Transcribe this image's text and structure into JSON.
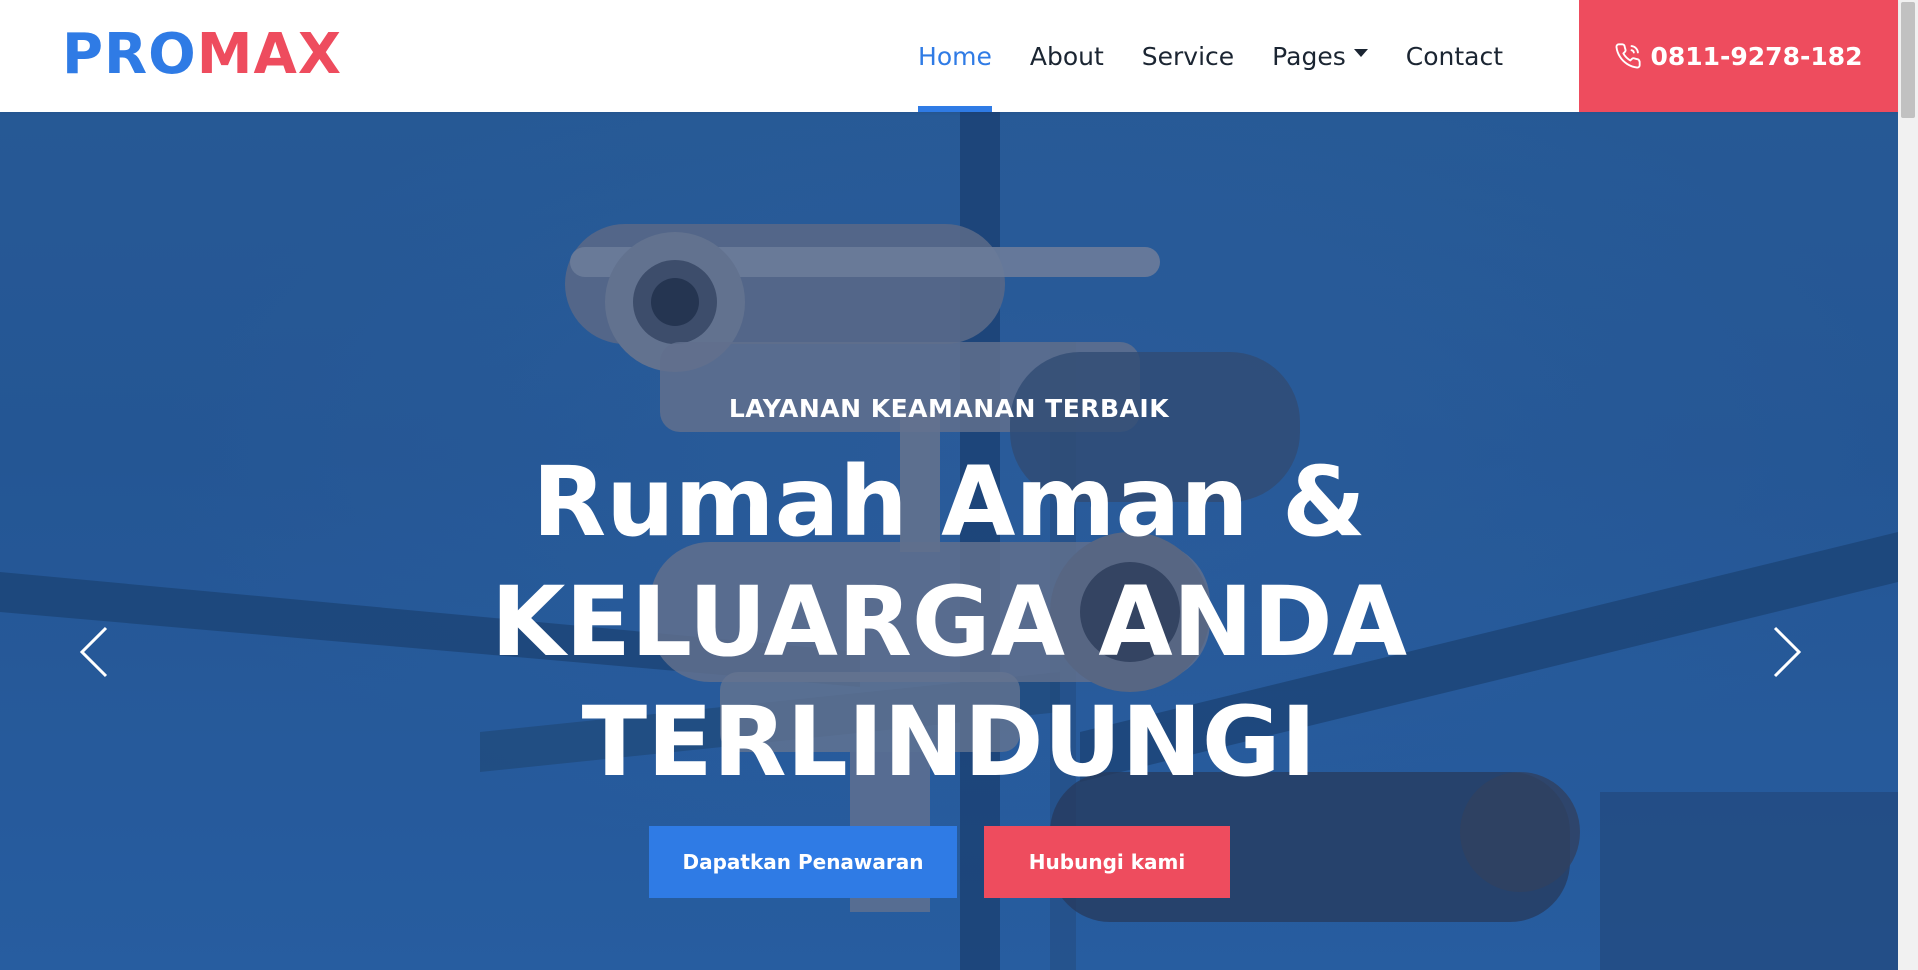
{
  "brand": {
    "part1": "PRO",
    "part2": "MAX"
  },
  "nav": {
    "items": [
      {
        "label": "Home",
        "active": true
      },
      {
        "label": "About",
        "active": false
      },
      {
        "label": "Service",
        "active": false
      },
      {
        "label": "Pages",
        "active": false,
        "dropdown": true
      },
      {
        "label": "Contact",
        "active": false
      }
    ]
  },
  "phone": {
    "number": "0811-9278-182",
    "icon": "phone-icon"
  },
  "hero": {
    "subtitle": "LAYANAN KEAMANAN TERBAIK",
    "headline_line1": "Rumah Aman &",
    "headline_line2": "KELUARGA ANDA",
    "headline_line3": "TERLINDUNGI",
    "primary_button": "Dapatkan Penawaran",
    "secondary_button": "Hubungi kami"
  },
  "colors": {
    "accent_blue": "#2f7be5",
    "accent_red": "#ee4c5e",
    "text_dark": "#1b2532"
  }
}
